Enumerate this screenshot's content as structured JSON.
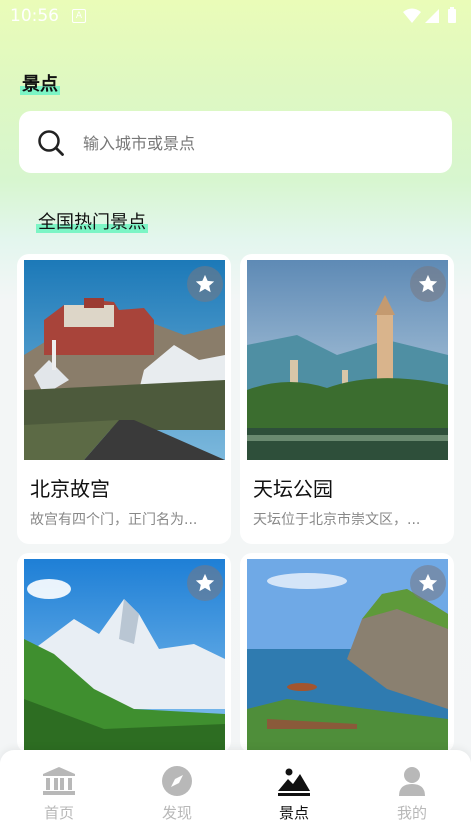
{
  "status_bar": {
    "time": "10:56",
    "notification_icon": "A"
  },
  "page": {
    "title": "景点"
  },
  "search": {
    "placeholder": "输入城市或景点",
    "value": ""
  },
  "section": {
    "title": "全国热门景点"
  },
  "cards": [
    {
      "title": "北京故宫",
      "desc": "故宫有四个门，正门名为..."
    },
    {
      "title": "天坛公园",
      "desc": "天坛位于北京市崇文区，..."
    },
    {
      "title": "",
      "desc": ""
    },
    {
      "title": "",
      "desc": ""
    }
  ],
  "tabs": [
    {
      "label": "首页",
      "icon": "temple-icon",
      "active": false
    },
    {
      "label": "发现",
      "icon": "compass-icon",
      "active": false
    },
    {
      "label": "景点",
      "icon": "mountain-icon",
      "active": true
    },
    {
      "label": "我的",
      "icon": "user-icon",
      "active": false
    }
  ],
  "colors": {
    "highlight": "#7cf5c5",
    "tab_inactive": "#b8b8b8",
    "tab_active": "#111111"
  }
}
